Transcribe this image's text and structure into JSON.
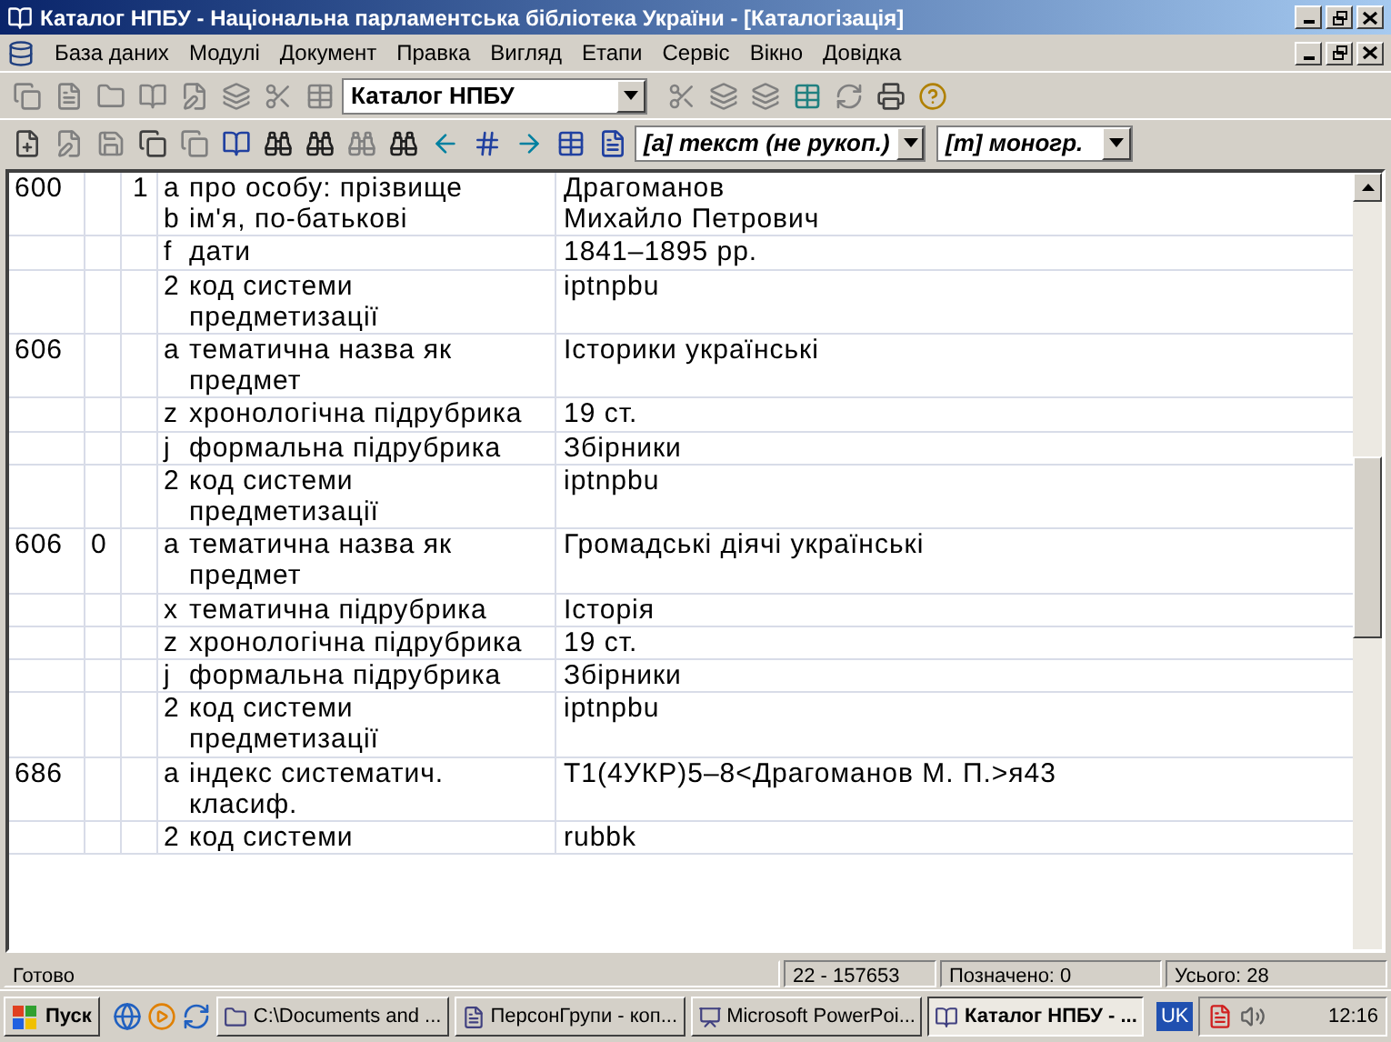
{
  "window": {
    "title": "Каталог НПБУ - Національна парламентська бібліотека України - [Каталогізація]"
  },
  "menu": [
    "База даних",
    "Модулі",
    "Документ",
    "Правка",
    "Вигляд",
    "Етапи",
    "Сервіс",
    "Вікно",
    "Довідка"
  ],
  "toolbar": {
    "catalog_select": "Каталог НПБУ",
    "type_select": "[a] текст (не рукоп.)",
    "level_select": "[m] моногр."
  },
  "rows": [
    {
      "tag": "600",
      "ind1": "",
      "ind2": "1",
      "subfields": [
        {
          "code": "a",
          "label": "про особу: прізвище",
          "value": "Драгоманов"
        },
        {
          "code": "b",
          "label": "ім'я, по-батькові",
          "value": "Михайло Петрович"
        }
      ]
    },
    {
      "tag": "",
      "ind1": "",
      "ind2": "",
      "subfields": [
        {
          "code": "f",
          "label": "дати",
          "value": "1841–1895 рр."
        }
      ]
    },
    {
      "tag": "",
      "ind1": "",
      "ind2": "",
      "subfields": [
        {
          "code": "2",
          "label": "код системи предметизації",
          "value": "iptnpbu"
        }
      ]
    },
    {
      "tag": "606",
      "ind1": "",
      "ind2": "",
      "subfields": [
        {
          "code": "a",
          "label": "тематична назва як предмет",
          "value": "Історики українські"
        }
      ]
    },
    {
      "tag": "",
      "ind1": "",
      "ind2": "",
      "subfields": [
        {
          "code": "z",
          "label": "хронологічна підрубрика",
          "value": "19 ст."
        }
      ]
    },
    {
      "tag": "",
      "ind1": "",
      "ind2": "",
      "subfields": [
        {
          "code": "j",
          "label": "формальна підрубрика",
          "value": "Збірники"
        }
      ]
    },
    {
      "tag": "",
      "ind1": "",
      "ind2": "",
      "subfields": [
        {
          "code": "2",
          "label": "код системи предметизації",
          "value": "iptnpbu"
        }
      ]
    },
    {
      "tag": "606",
      "ind1": "0",
      "ind2": "",
      "subfields": [
        {
          "code": "a",
          "label": "тематична назва як предмет",
          "value": "Громадські діячі українські"
        }
      ]
    },
    {
      "tag": "",
      "ind1": "",
      "ind2": "",
      "subfields": [
        {
          "code": "x",
          "label": "тематична підрубрика",
          "value": "Історія"
        }
      ]
    },
    {
      "tag": "",
      "ind1": "",
      "ind2": "",
      "subfields": [
        {
          "code": "z",
          "label": "хронологічна підрубрика",
          "value": "19 ст."
        }
      ]
    },
    {
      "tag": "",
      "ind1": "",
      "ind2": "",
      "subfields": [
        {
          "code": "j",
          "label": "формальна підрубрика",
          "value": "Збірники"
        }
      ]
    },
    {
      "tag": "",
      "ind1": "",
      "ind2": "",
      "subfields": [
        {
          "code": "2",
          "label": "код системи предметизації",
          "value": "iptnpbu"
        }
      ]
    },
    {
      "tag": "686",
      "ind1": "",
      "ind2": "",
      "subfields": [
        {
          "code": "a",
          "label": "індекс систематич. класиф.",
          "value": "Т1(4УКР)5–8<Драгоманов М. П.>я43"
        }
      ]
    },
    {
      "tag": "",
      "ind1": "",
      "ind2": "",
      "subfields": [
        {
          "code": "2",
          "label": "код системи",
          "value": "rubbk"
        }
      ]
    }
  ],
  "status_bar": [
    "Готово",
    "22 - 157653",
    "Позначено: 0",
    "Усього: 28"
  ],
  "taskbar": {
    "start": "Пуск",
    "tasks": [
      {
        "label": "C:\\Documents and ...",
        "selected": false
      },
      {
        "label": "ПерсонГрупи - коп...",
        "selected": false
      },
      {
        "label": "Microsoft PowerPoi...",
        "selected": false
      },
      {
        "label": "Каталог НПБУ - ...",
        "selected": true
      }
    ],
    "language": "UK",
    "time": "12:16"
  }
}
